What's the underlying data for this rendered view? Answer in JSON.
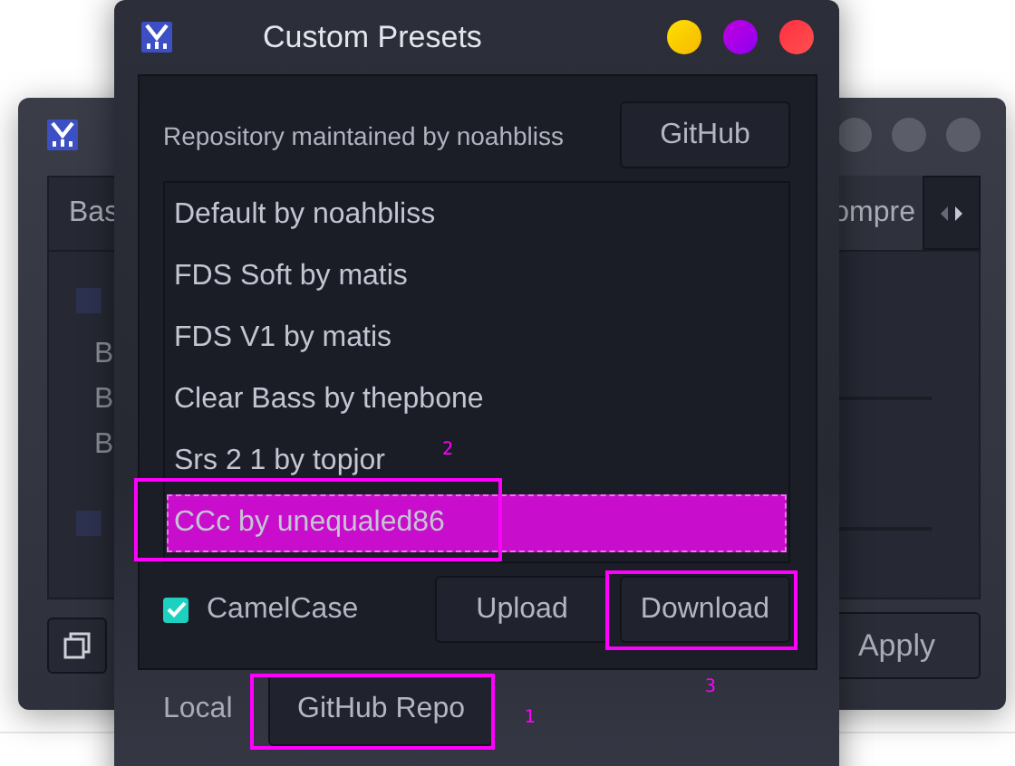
{
  "back_window": {
    "tabs": [
      {
        "label": "Bas",
        "selected": true
      },
      {
        "label": "ompre",
        "selected": false
      }
    ],
    "checkboxes": [
      {
        "checked": false
      },
      {
        "checked": false
      }
    ],
    "rows": [
      "B",
      "B",
      "B"
    ],
    "apply_button": "Apply"
  },
  "dialog": {
    "title": "Custom Presets",
    "repo_label": "Repository maintained by noahbliss",
    "github_button": "GitHub",
    "presets": [
      {
        "label": "Default by noahbliss",
        "selected": false
      },
      {
        "label": "FDS Soft by matis",
        "selected": false
      },
      {
        "label": "FDS V1 by matis",
        "selected": false
      },
      {
        "label": "Clear Bass by thepbone",
        "selected": false
      },
      {
        "label": "Srs 2 1 by topjor",
        "selected": false
      },
      {
        "label": "CCc by unequaled86",
        "selected": true,
        "annotation": "2"
      }
    ],
    "camelcase": {
      "label": "CamelCase",
      "checked": true
    },
    "upload_button": {
      "label": "Upload"
    },
    "download_button": {
      "label": "Download",
      "annotation": "3"
    },
    "local_label": "Local",
    "github_repo_button": {
      "label": "GitHub Repo",
      "annotation": "1"
    }
  }
}
